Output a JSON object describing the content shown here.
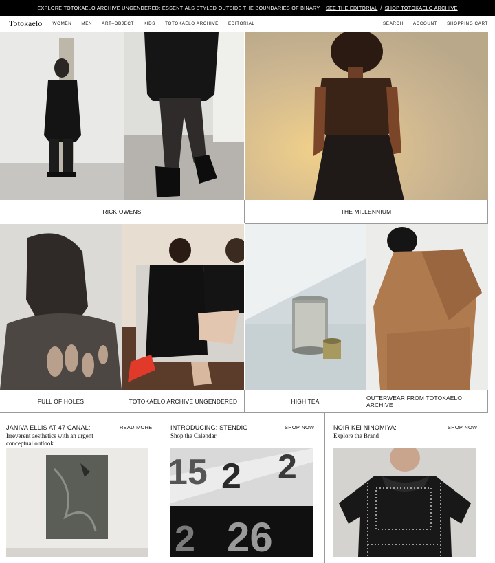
{
  "banner": {
    "text": "EXPLORE TOTOKAELO ARCHIVE UNGENDERED: ESSENTIALS STYLED OUTSIDE THE BOUNDARIES OF BINARY |",
    "link1": "SEE THE EDITORIAL",
    "sep": "/",
    "link2": "SHOP TOTOKAELO ARCHIVE"
  },
  "nav": {
    "logo": "Totokaelo",
    "items": [
      "WOMEN",
      "MEN",
      "ART–OBJECT",
      "KIDS",
      "TOTOKAELO ARCHIVE",
      "EDITORIAL"
    ],
    "right": [
      "SEARCH",
      "ACCOUNT",
      "SHOPPING CART"
    ]
  },
  "features": [
    {
      "label": "RICK OWENS"
    },
    {
      "label": "THE MILLENNIUM"
    }
  ],
  "grid": [
    {
      "label": "FULL OF HOLES"
    },
    {
      "label": "TOTOKAELO ARCHIVE UNGENDERED"
    },
    {
      "label": "HIGH TEA"
    },
    {
      "label": "OUTERWEAR FROM TOTOKAELO ARCHIVE"
    }
  ],
  "stories": [
    {
      "title": "JANIVA ELLIS AT 47 CANAL:",
      "subtitle": "Irreverent aesthetics with an urgent conceptual outlook",
      "action": "READ MORE"
    },
    {
      "title": "INTRODUCING: STENDIG",
      "subtitle": "Shop the Calendar",
      "action": "SHOP NOW",
      "calendar_digits": [
        "15",
        "2",
        "2",
        "26",
        "2"
      ]
    },
    {
      "title": "NOIR KEI NINOMIYA:",
      "subtitle": "Explore the Brand",
      "action": "SHOP NOW"
    }
  ]
}
